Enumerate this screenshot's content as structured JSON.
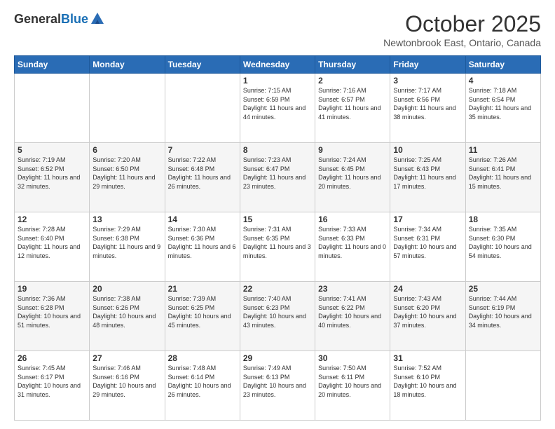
{
  "logo": {
    "general": "General",
    "blue": "Blue"
  },
  "title": "October 2025",
  "subtitle": "Newtonbrook East, Ontario, Canada",
  "days_of_week": [
    "Sunday",
    "Monday",
    "Tuesday",
    "Wednesday",
    "Thursday",
    "Friday",
    "Saturday"
  ],
  "weeks": [
    [
      {
        "day": "",
        "info": ""
      },
      {
        "day": "",
        "info": ""
      },
      {
        "day": "",
        "info": ""
      },
      {
        "day": "1",
        "info": "Sunrise: 7:15 AM\nSunset: 6:59 PM\nDaylight: 11 hours and 44 minutes."
      },
      {
        "day": "2",
        "info": "Sunrise: 7:16 AM\nSunset: 6:57 PM\nDaylight: 11 hours and 41 minutes."
      },
      {
        "day": "3",
        "info": "Sunrise: 7:17 AM\nSunset: 6:56 PM\nDaylight: 11 hours and 38 minutes."
      },
      {
        "day": "4",
        "info": "Sunrise: 7:18 AM\nSunset: 6:54 PM\nDaylight: 11 hours and 35 minutes."
      }
    ],
    [
      {
        "day": "5",
        "info": "Sunrise: 7:19 AM\nSunset: 6:52 PM\nDaylight: 11 hours and 32 minutes."
      },
      {
        "day": "6",
        "info": "Sunrise: 7:20 AM\nSunset: 6:50 PM\nDaylight: 11 hours and 29 minutes."
      },
      {
        "day": "7",
        "info": "Sunrise: 7:22 AM\nSunset: 6:48 PM\nDaylight: 11 hours and 26 minutes."
      },
      {
        "day": "8",
        "info": "Sunrise: 7:23 AM\nSunset: 6:47 PM\nDaylight: 11 hours and 23 minutes."
      },
      {
        "day": "9",
        "info": "Sunrise: 7:24 AM\nSunset: 6:45 PM\nDaylight: 11 hours and 20 minutes."
      },
      {
        "day": "10",
        "info": "Sunrise: 7:25 AM\nSunset: 6:43 PM\nDaylight: 11 hours and 17 minutes."
      },
      {
        "day": "11",
        "info": "Sunrise: 7:26 AM\nSunset: 6:41 PM\nDaylight: 11 hours and 15 minutes."
      }
    ],
    [
      {
        "day": "12",
        "info": "Sunrise: 7:28 AM\nSunset: 6:40 PM\nDaylight: 11 hours and 12 minutes."
      },
      {
        "day": "13",
        "info": "Sunrise: 7:29 AM\nSunset: 6:38 PM\nDaylight: 11 hours and 9 minutes."
      },
      {
        "day": "14",
        "info": "Sunrise: 7:30 AM\nSunset: 6:36 PM\nDaylight: 11 hours and 6 minutes."
      },
      {
        "day": "15",
        "info": "Sunrise: 7:31 AM\nSunset: 6:35 PM\nDaylight: 11 hours and 3 minutes."
      },
      {
        "day": "16",
        "info": "Sunrise: 7:33 AM\nSunset: 6:33 PM\nDaylight: 11 hours and 0 minutes."
      },
      {
        "day": "17",
        "info": "Sunrise: 7:34 AM\nSunset: 6:31 PM\nDaylight: 10 hours and 57 minutes."
      },
      {
        "day": "18",
        "info": "Sunrise: 7:35 AM\nSunset: 6:30 PM\nDaylight: 10 hours and 54 minutes."
      }
    ],
    [
      {
        "day": "19",
        "info": "Sunrise: 7:36 AM\nSunset: 6:28 PM\nDaylight: 10 hours and 51 minutes."
      },
      {
        "day": "20",
        "info": "Sunrise: 7:38 AM\nSunset: 6:26 PM\nDaylight: 10 hours and 48 minutes."
      },
      {
        "day": "21",
        "info": "Sunrise: 7:39 AM\nSunset: 6:25 PM\nDaylight: 10 hours and 45 minutes."
      },
      {
        "day": "22",
        "info": "Sunrise: 7:40 AM\nSunset: 6:23 PM\nDaylight: 10 hours and 43 minutes."
      },
      {
        "day": "23",
        "info": "Sunrise: 7:41 AM\nSunset: 6:22 PM\nDaylight: 10 hours and 40 minutes."
      },
      {
        "day": "24",
        "info": "Sunrise: 7:43 AM\nSunset: 6:20 PM\nDaylight: 10 hours and 37 minutes."
      },
      {
        "day": "25",
        "info": "Sunrise: 7:44 AM\nSunset: 6:19 PM\nDaylight: 10 hours and 34 minutes."
      }
    ],
    [
      {
        "day": "26",
        "info": "Sunrise: 7:45 AM\nSunset: 6:17 PM\nDaylight: 10 hours and 31 minutes."
      },
      {
        "day": "27",
        "info": "Sunrise: 7:46 AM\nSunset: 6:16 PM\nDaylight: 10 hours and 29 minutes."
      },
      {
        "day": "28",
        "info": "Sunrise: 7:48 AM\nSunset: 6:14 PM\nDaylight: 10 hours and 26 minutes."
      },
      {
        "day": "29",
        "info": "Sunrise: 7:49 AM\nSunset: 6:13 PM\nDaylight: 10 hours and 23 minutes."
      },
      {
        "day": "30",
        "info": "Sunrise: 7:50 AM\nSunset: 6:11 PM\nDaylight: 10 hours and 20 minutes."
      },
      {
        "day": "31",
        "info": "Sunrise: 7:52 AM\nSunset: 6:10 PM\nDaylight: 10 hours and 18 minutes."
      },
      {
        "day": "",
        "info": ""
      }
    ]
  ]
}
